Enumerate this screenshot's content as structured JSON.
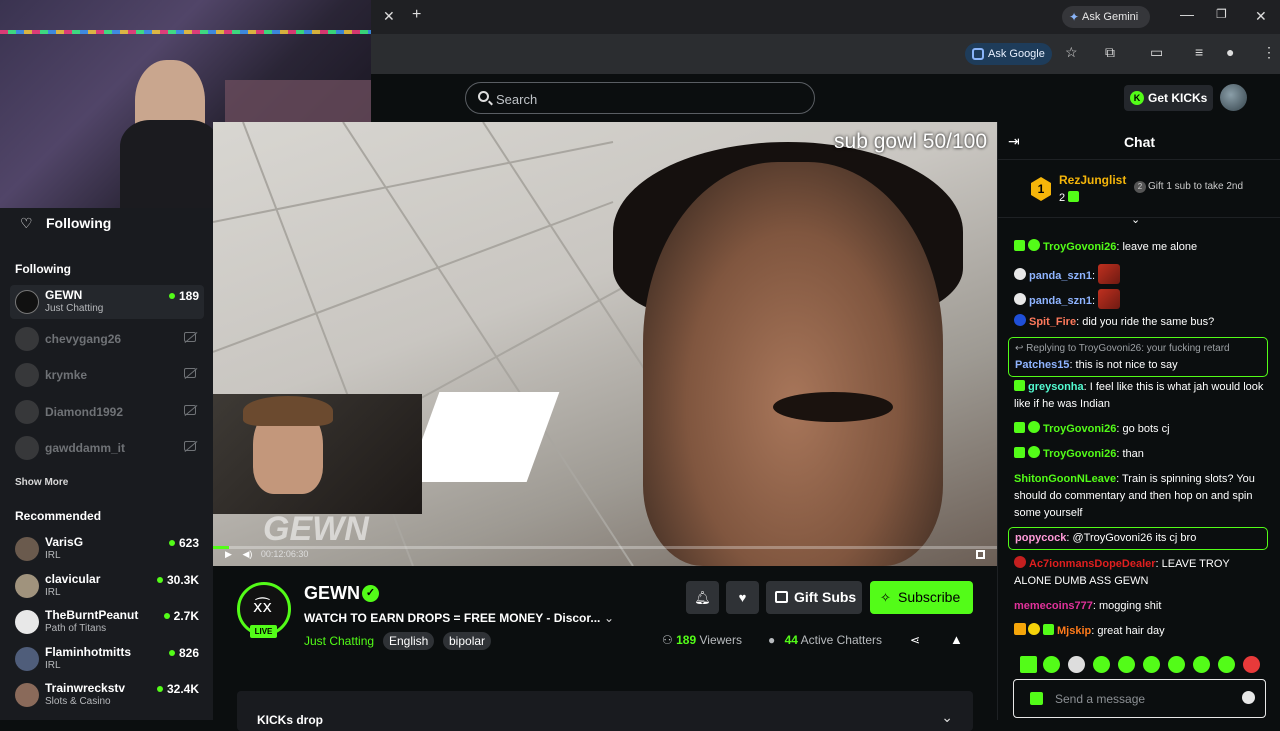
{
  "browser": {
    "ask_gemini": "Ask Gemini",
    "ask_google": "Ask Google"
  },
  "header": {
    "search_placeholder": "Search",
    "get_kicks": "Get KICKs"
  },
  "sidebar": {
    "following_heading": "Following",
    "following_label": "Following",
    "following": [
      {
        "name": "GEWN",
        "sub": "Just Chatting",
        "count": "189",
        "live": true
      },
      {
        "name": "chevygang26",
        "live": false
      },
      {
        "name": "krymke",
        "live": false
      },
      {
        "name": "Diamond1992",
        "live": false
      },
      {
        "name": "gawddamm_it",
        "live": false
      }
    ],
    "show_more": "Show More",
    "recommended_label": "Recommended",
    "recommended": [
      {
        "name": "VarisG",
        "sub": "IRL",
        "count": "623"
      },
      {
        "name": "clavicular",
        "sub": "IRL",
        "count": "30.3K"
      },
      {
        "name": "TheBurntPeanut",
        "sub": "Path of Titans",
        "count": "2.7K"
      },
      {
        "name": "Flaminhotmitts",
        "sub": "IRL",
        "count": "826"
      },
      {
        "name": "Trainwreckstv",
        "sub": "Slots & Casino",
        "count": "32.4K"
      }
    ]
  },
  "video": {
    "overlay_text": "sub gowl 50/100",
    "watermark": "GEWN",
    "time": "00:12:06:30",
    "progress": 0.02
  },
  "stream": {
    "channel": "GEWN",
    "live": "LIVE",
    "title": "WATCH TO EARN DROPS = FREE MONEY - Discor...",
    "category": "Just Chatting",
    "tags": [
      "English",
      "bipolar"
    ],
    "gift_subs": "Gift Subs",
    "subscribe": "Subscribe",
    "viewers_count": "189",
    "viewers_label": "Viewers",
    "chatters_count": "44",
    "chatters_label": "Active Chatters",
    "drops_title": "KICKs drop"
  },
  "chat": {
    "title": "Chat",
    "pinned": {
      "rank": "1",
      "user": "RezJunglist",
      "count": "2",
      "message": "Gift 1 sub to take 2nd"
    },
    "messages": [
      {
        "user": "TroyGovoni26",
        "color": "#53fc18",
        "text": " leave me alone"
      },
      {
        "user": "panda_szn1",
        "color": "#8fb4ff",
        "text": ""
      },
      {
        "user": "panda_szn1",
        "color": "#8fb4ff",
        "text": ""
      },
      {
        "user": "Spit_Fire",
        "color": "#ff7a5c",
        "text": " did you ride the same bus?"
      },
      {
        "reply": "Replying to TroyGovoni26: your fucking retard",
        "user": "Patches15",
        "color": "#8fb4ff",
        "text": " this is not nice to say"
      },
      {
        "user": "greysonha",
        "color": "#53fcd1",
        "text": " I feel like this is what jah would look like if he was Indian"
      },
      {
        "user": "TroyGovoni26",
        "color": "#53fc18",
        "text": " go bots cj"
      },
      {
        "user": "TroyGovoni26",
        "color": "#53fc18",
        "text": " than"
      },
      {
        "user": "ShitonGoonNLeave",
        "color": "#53fc18",
        "text": " Train is spinning slots? You should do commentary and then hop on and spin some yourself"
      },
      {
        "user": "popycock",
        "color": "#ff9ad8",
        "text": " @TroyGovoni26 its cj bro"
      },
      {
        "user": "Ac7ionmansDopeDealer",
        "color": "#e01f1f",
        "text": " LEAVE TROY ALONE DUMB ASS GEWN"
      },
      {
        "user": "memecoins777",
        "color": "#e0329a",
        "text": " mogging shit"
      },
      {
        "user": "Mjskip",
        "color": "#ff7a1a",
        "text": " great hair day"
      }
    ],
    "input_placeholder": "Send a message"
  },
  "colors": {
    "accent": "#53fc18",
    "background": "#0b0e0f",
    "sidebar": "#191b1f"
  }
}
